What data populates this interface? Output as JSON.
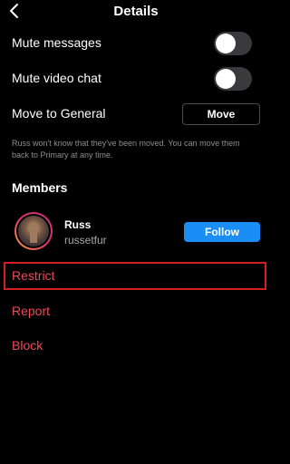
{
  "header": {
    "title": "Details",
    "back_icon": "chevron-left-icon"
  },
  "settings": {
    "mute_messages": {
      "label": "Mute messages",
      "enabled": false
    },
    "mute_video_chat": {
      "label": "Mute video chat",
      "enabled": false
    },
    "move_to_general": {
      "label": "Move to General",
      "button_label": "Move"
    }
  },
  "info_text": "Russ won't know that they've been moved. You can move them back to Primary at any time.",
  "members": {
    "heading": "Members",
    "items": [
      {
        "name": "Russ",
        "username": "russetfur",
        "follow_label": "Follow"
      }
    ]
  },
  "actions": {
    "restrict": "Restrict",
    "report": "Report",
    "block": "Block"
  },
  "colors": {
    "background": "#000000",
    "danger": "#ed4956",
    "follow_button": "#1a8ef5",
    "highlight_box": "#d21f1f",
    "secondary_text": "#8e8e8e"
  }
}
